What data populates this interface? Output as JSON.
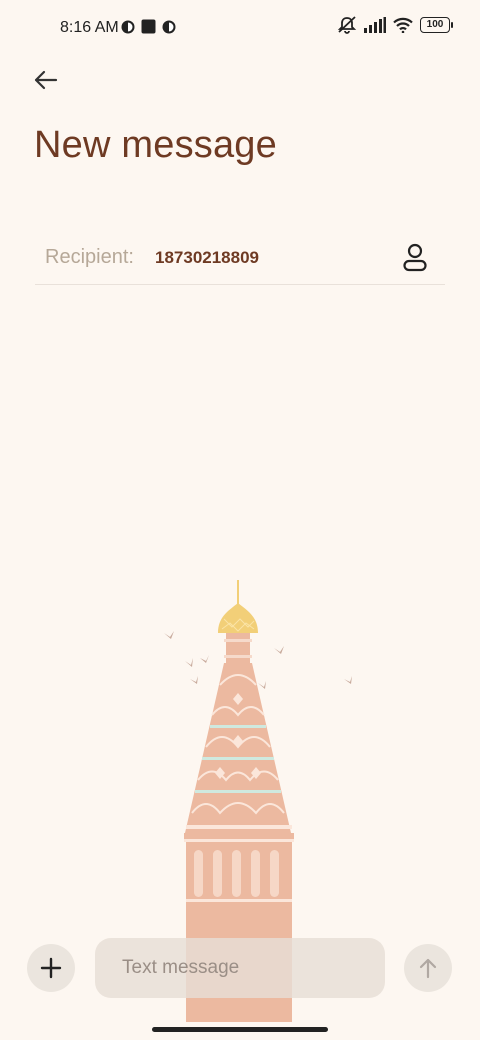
{
  "status_bar": {
    "time": "8:16 AM",
    "battery": "100",
    "left_icons": [
      "app-notification-icon",
      "square-notification-icon",
      "app-notification-icon"
    ],
    "right_icons": [
      "muted-bell-icon",
      "signal-icon",
      "wifi-icon",
      "battery-icon"
    ]
  },
  "header": {
    "back_icon": "arrow-left-icon",
    "title": "New message"
  },
  "recipient": {
    "label": "Recipient:",
    "value": "18730218809",
    "contacts_icon": "person-icon"
  },
  "composer": {
    "attach_icon": "plus-icon",
    "placeholder": "Text message",
    "send_icon": "arrow-up-icon"
  },
  "colors": {
    "background": "#fdf7f1",
    "title": "#6e3a23",
    "label": "#b6a898",
    "tower": "#ecb9a0",
    "dome": "#f2cf78"
  }
}
